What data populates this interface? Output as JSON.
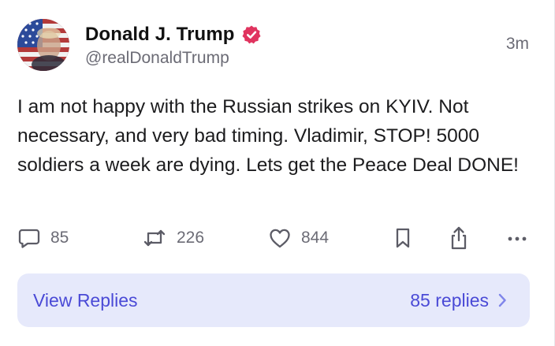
{
  "author": {
    "display_name": "Donald J. Trump",
    "handle": "@realDonaldTrump",
    "verified": true,
    "verified_color": "#e0345f",
    "avatar_icon": "profile-photo-flag"
  },
  "timestamp": "3m",
  "post": {
    "text": "I am not happy with the Russian strikes on KYIV. Not necessary, and very bad timing. Vladimir, STOP! 5000 soldiers a week are dying. Lets get the Peace Deal DONE!"
  },
  "actions": {
    "reply": {
      "icon": "speech-bubble-icon",
      "count": "85"
    },
    "repost": {
      "icon": "repost-arrows-icon",
      "count": "226"
    },
    "like": {
      "icon": "heart-icon",
      "count": "844"
    },
    "bookmark": {
      "icon": "bookmark-icon"
    },
    "share": {
      "icon": "share-icon"
    },
    "more": {
      "icon": "more-dots-icon"
    }
  },
  "replies": {
    "view_label": "View Replies",
    "count_label": "85 replies",
    "background": "#e6e9fb",
    "accent": "#4a4ad6"
  }
}
